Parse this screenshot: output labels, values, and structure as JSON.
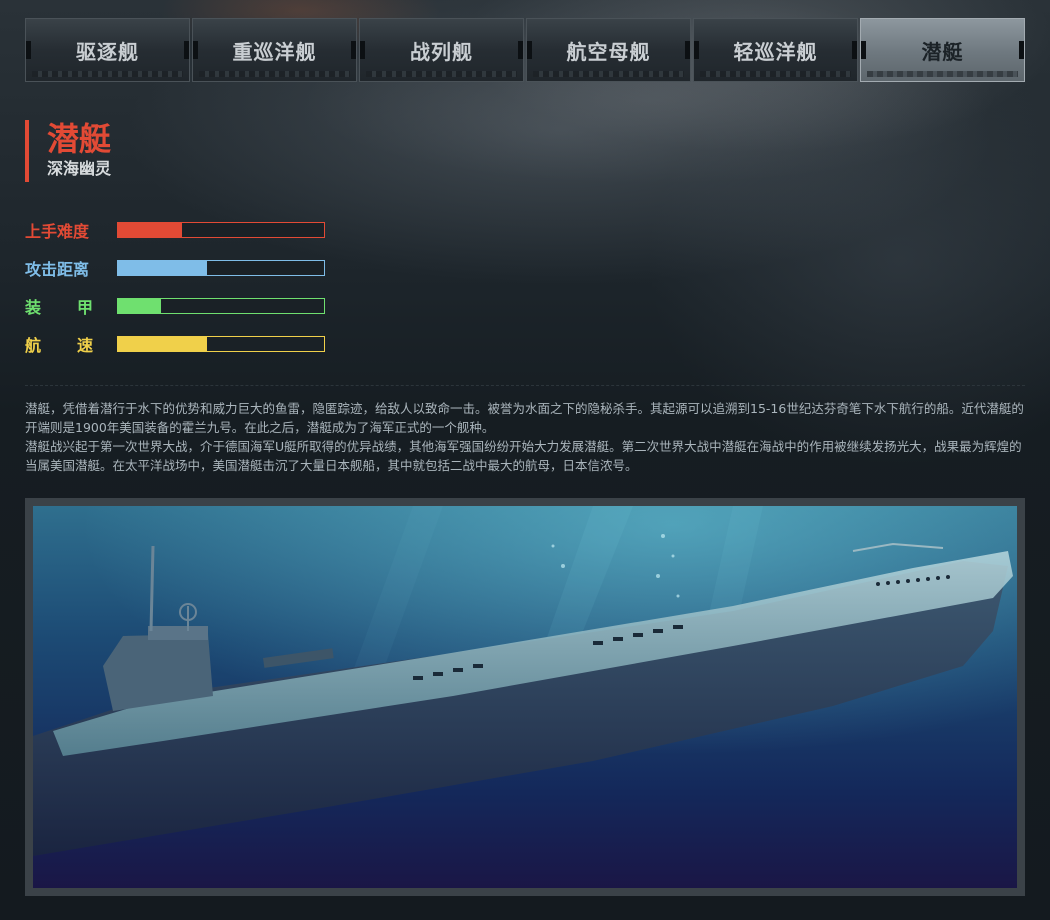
{
  "tabs": [
    {
      "label": "驱逐舰",
      "active": false
    },
    {
      "label": "重巡洋舰",
      "active": false
    },
    {
      "label": "战列舰",
      "active": false
    },
    {
      "label": "航空母舰",
      "active": false
    },
    {
      "label": "轻巡洋舰",
      "active": false
    },
    {
      "label": "潜艇",
      "active": true
    }
  ],
  "ship": {
    "title": "潜艇",
    "subtitle": "深海幽灵"
  },
  "stats": [
    {
      "label": "上手难度",
      "label_chars": [
        "上手难度"
      ],
      "value": 0.31,
      "color": "#e24a35"
    },
    {
      "label": "攻击距离",
      "label_chars": [
        "攻击距离"
      ],
      "value": 0.43,
      "color": "#7fbde8"
    },
    {
      "label": "装甲",
      "label_chars": [
        "装",
        "甲"
      ],
      "value": 0.21,
      "color": "#6fe06f"
    },
    {
      "label": "航速",
      "label_chars": [
        "航",
        "速"
      ],
      "value": 0.43,
      "color": "#f0d04a"
    }
  ],
  "description": [
    "潜艇，凭借着潜行于水下的优势和威力巨大的鱼雷，隐匿踪迹，给敌人以致命一击。被誉为水面之下的隐秘杀手。其起源可以追溯到15-16世纪达芬奇笔下水下航行的船。近代潜艇的开端则是1900年美国装备的霍兰九号。在此之后，潜艇成为了海军正式的一个舰种。",
    "潜艇战兴起于第一次世界大战，介于德国海军U艇所取得的优异战绩，其他海军强国纷纷开始大力发展潜艇。第二次世界大战中潜艇在海战中的作用被继续发扬光大，战果最为辉煌的当属美国潜艇。在太平洋战场中，美国潜艇击沉了大量日本舰船，其中就包括二战中最大的航母，日本信浓号。"
  ]
}
